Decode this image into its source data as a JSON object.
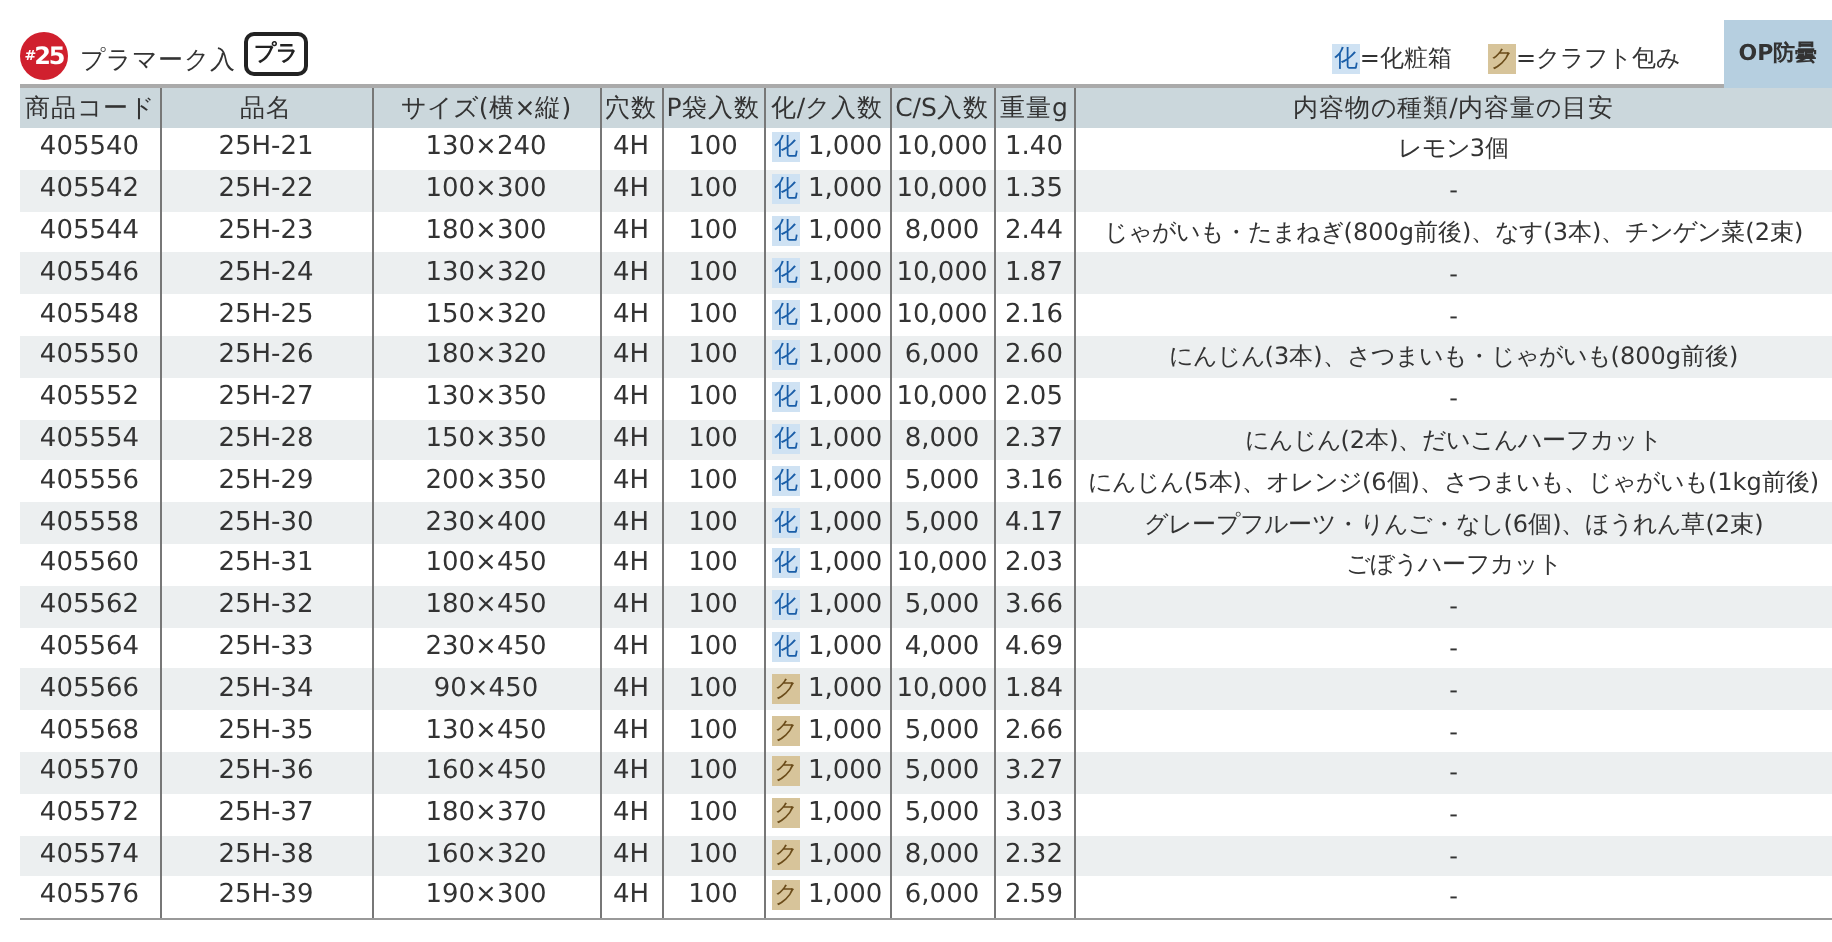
{
  "header": {
    "number_hash": "#",
    "number": "25",
    "title": "プラマーク入",
    "mark_text": "プラ"
  },
  "legend": [
    {
      "kind": "cosmetic",
      "tag": "化",
      "text": "=化粧箱"
    },
    {
      "kind": "kraft",
      "tag": "ク",
      "text": "=クラフト包み"
    }
  ],
  "badge": "OP防曇",
  "table": {
    "columns": [
      "商品コード",
      "品名",
      "サイズ(横×縦)",
      "穴数",
      "P袋入数",
      "化/ク入数",
      "C/S入数",
      "重量g",
      "内容物の種類/内容量の目安"
    ],
    "rows": [
      {
        "kind": "cosmetic",
        "code": "405540",
        "name": "25H-21",
        "size": "130×240",
        "holes": "4H",
        "p_qty": "100",
        "pack_tag": "化",
        "pack_qty": "1,000",
        "cs_qty": "10,000",
        "weight": "1.40",
        "contents": "レモン3個"
      },
      {
        "kind": "cosmetic",
        "code": "405542",
        "name": "25H-22",
        "size": "100×300",
        "holes": "4H",
        "p_qty": "100",
        "pack_tag": "化",
        "pack_qty": "1,000",
        "cs_qty": "10,000",
        "weight": "1.35",
        "contents": "-"
      },
      {
        "kind": "cosmetic",
        "code": "405544",
        "name": "25H-23",
        "size": "180×300",
        "holes": "4H",
        "p_qty": "100",
        "pack_tag": "化",
        "pack_qty": "1,000",
        "cs_qty": "8,000",
        "weight": "2.44",
        "contents": "じゃがいも・たまねぎ(800g前後)、なす(3本)、チンゲン菜(2束)"
      },
      {
        "kind": "cosmetic",
        "code": "405546",
        "name": "25H-24",
        "size": "130×320",
        "holes": "4H",
        "p_qty": "100",
        "pack_tag": "化",
        "pack_qty": "1,000",
        "cs_qty": "10,000",
        "weight": "1.87",
        "contents": "-"
      },
      {
        "kind": "cosmetic",
        "code": "405548",
        "name": "25H-25",
        "size": "150×320",
        "holes": "4H",
        "p_qty": "100",
        "pack_tag": "化",
        "pack_qty": "1,000",
        "cs_qty": "10,000",
        "weight": "2.16",
        "contents": "-"
      },
      {
        "kind": "cosmetic",
        "code": "405550",
        "name": "25H-26",
        "size": "180×320",
        "holes": "4H",
        "p_qty": "100",
        "pack_tag": "化",
        "pack_qty": "1,000",
        "cs_qty": "6,000",
        "weight": "2.60",
        "contents": "にんじん(3本)、さつまいも・じゃがいも(800g前後)"
      },
      {
        "kind": "cosmetic",
        "code": "405552",
        "name": "25H-27",
        "size": "130×350",
        "holes": "4H",
        "p_qty": "100",
        "pack_tag": "化",
        "pack_qty": "1,000",
        "cs_qty": "10,000",
        "weight": "2.05",
        "contents": "-"
      },
      {
        "kind": "cosmetic",
        "code": "405554",
        "name": "25H-28",
        "size": "150×350",
        "holes": "4H",
        "p_qty": "100",
        "pack_tag": "化",
        "pack_qty": "1,000",
        "cs_qty": "8,000",
        "weight": "2.37",
        "contents": "にんじん(2本)、だいこんハーフカット"
      },
      {
        "kind": "cosmetic",
        "code": "405556",
        "name": "25H-29",
        "size": "200×350",
        "holes": "4H",
        "p_qty": "100",
        "pack_tag": "化",
        "pack_qty": "1,000",
        "cs_qty": "5,000",
        "weight": "3.16",
        "contents": "にんじん(5本)、オレンジ(6個)、さつまいも、じゃがいも(1kg前後)"
      },
      {
        "kind": "cosmetic",
        "code": "405558",
        "name": "25H-30",
        "size": "230×400",
        "holes": "4H",
        "p_qty": "100",
        "pack_tag": "化",
        "pack_qty": "1,000",
        "cs_qty": "5,000",
        "weight": "4.17",
        "contents": "グレープフルーツ・りんご・なし(6個)、ほうれん草(2束)"
      },
      {
        "kind": "cosmetic",
        "code": "405560",
        "name": "25H-31",
        "size": "100×450",
        "holes": "4H",
        "p_qty": "100",
        "pack_tag": "化",
        "pack_qty": "1,000",
        "cs_qty": "10,000",
        "weight": "2.03",
        "contents": "ごぼうハーフカット"
      },
      {
        "kind": "cosmetic",
        "code": "405562",
        "name": "25H-32",
        "size": "180×450",
        "holes": "4H",
        "p_qty": "100",
        "pack_tag": "化",
        "pack_qty": "1,000",
        "cs_qty": "5,000",
        "weight": "3.66",
        "contents": "-"
      },
      {
        "kind": "cosmetic",
        "code": "405564",
        "name": "25H-33",
        "size": "230×450",
        "holes": "4H",
        "p_qty": "100",
        "pack_tag": "化",
        "pack_qty": "1,000",
        "cs_qty": "4,000",
        "weight": "4.69",
        "contents": "-"
      },
      {
        "kind": "kraft",
        "code": "405566",
        "name": "25H-34",
        "size": "90×450",
        "holes": "4H",
        "p_qty": "100",
        "pack_tag": "ク",
        "pack_qty": "1,000",
        "cs_qty": "10,000",
        "weight": "1.84",
        "contents": "-"
      },
      {
        "kind": "kraft",
        "code": "405568",
        "name": "25H-35",
        "size": "130×450",
        "holes": "4H",
        "p_qty": "100",
        "pack_tag": "ク",
        "pack_qty": "1,000",
        "cs_qty": "5,000",
        "weight": "2.66",
        "contents": "-"
      },
      {
        "kind": "kraft",
        "code": "405570",
        "name": "25H-36",
        "size": "160×450",
        "holes": "4H",
        "p_qty": "100",
        "pack_tag": "ク",
        "pack_qty": "1,000",
        "cs_qty": "5,000",
        "weight": "3.27",
        "contents": "-"
      },
      {
        "kind": "kraft",
        "code": "405572",
        "name": "25H-37",
        "size": "180×370",
        "holes": "4H",
        "p_qty": "100",
        "pack_tag": "ク",
        "pack_qty": "1,000",
        "cs_qty": "5,000",
        "weight": "3.03",
        "contents": "-"
      },
      {
        "kind": "kraft",
        "code": "405574",
        "name": "25H-38",
        "size": "160×320",
        "holes": "4H",
        "p_qty": "100",
        "pack_tag": "ク",
        "pack_qty": "1,000",
        "cs_qty": "8,000",
        "weight": "2.32",
        "contents": "-"
      },
      {
        "kind": "kraft",
        "code": "405576",
        "name": "25H-39",
        "size": "190×300",
        "holes": "4H",
        "p_qty": "100",
        "pack_tag": "ク",
        "pack_qty": "1,000",
        "cs_qty": "6,000",
        "weight": "2.59",
        "contents": "-"
      }
    ]
  }
}
